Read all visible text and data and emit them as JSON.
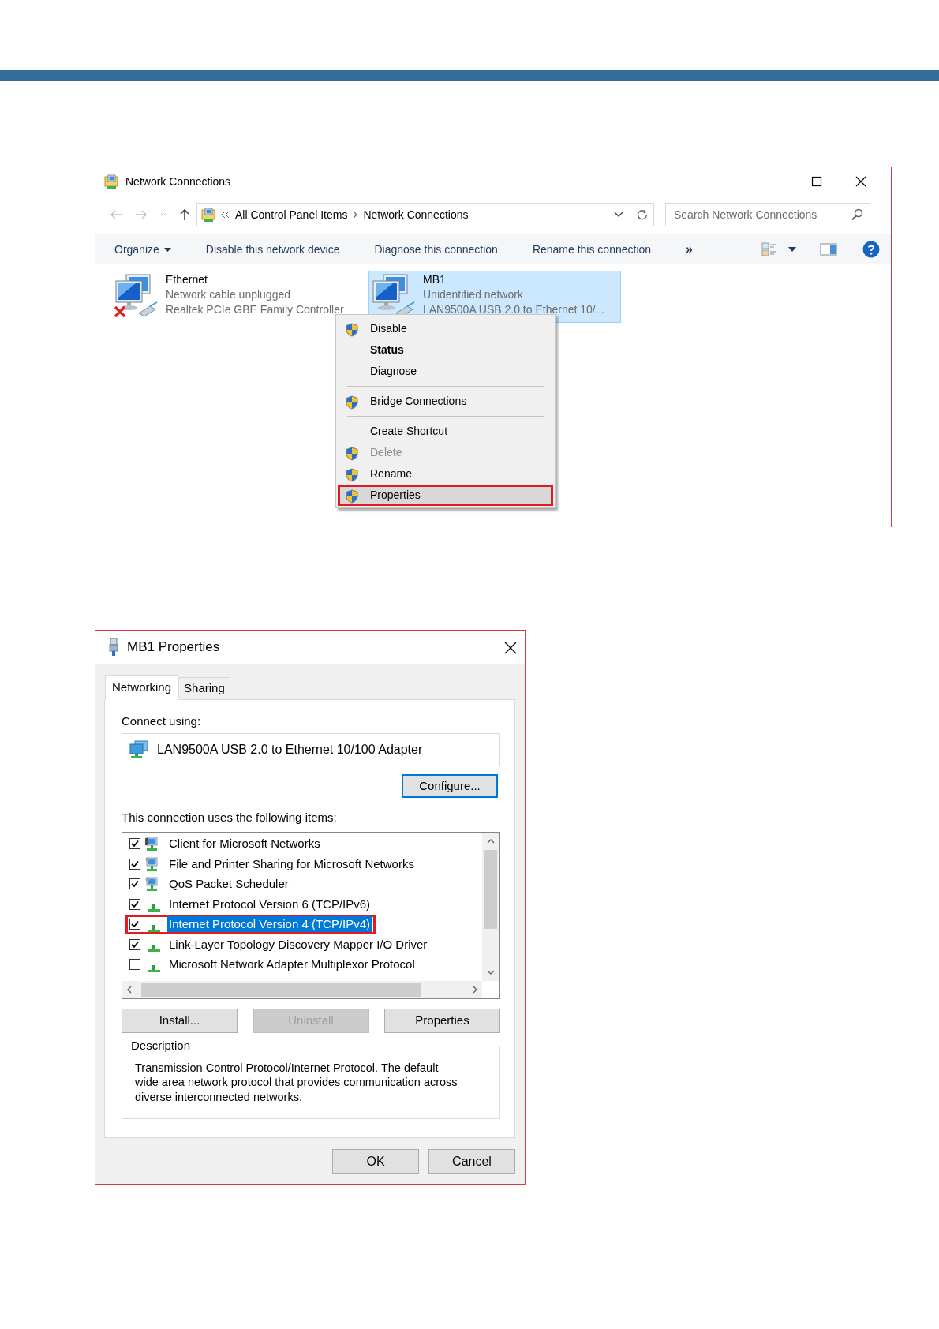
{
  "network_window": {
    "title": "Network Connections",
    "breadcrumb": [
      "All Control Panel Items",
      "Network Connections"
    ],
    "search": {
      "placeholder": "Search Network Connections"
    },
    "toolbar": [
      {
        "label": "Organize",
        "kind": "menu"
      },
      {
        "label": "Disable this network device",
        "kind": "command"
      },
      {
        "label": "Diagnose this connection",
        "kind": "command"
      },
      {
        "label": "Rename this connection",
        "kind": "command"
      },
      {
        "label": "»",
        "kind": "more"
      }
    ],
    "connections": [
      {
        "name": "Ethernet",
        "status": "Network cable unplugged",
        "device": "Realtek PCIe GBE Family Controller",
        "selected": false,
        "disconnected": true
      },
      {
        "name": "MB1",
        "status": "Unidentified network",
        "device": "LAN9500A USB 2.0 to Ethernet 10/...",
        "selected": true,
        "disconnected": false
      }
    ],
    "context_menu": [
      {
        "kind": "item",
        "label": "Disable",
        "shield": true,
        "bold": false,
        "disabled": false,
        "selected": false,
        "annotated": false
      },
      {
        "kind": "item",
        "label": "Status",
        "shield": false,
        "bold": true,
        "disabled": false,
        "selected": false,
        "annotated": false
      },
      {
        "kind": "item",
        "label": "Diagnose",
        "shield": false,
        "bold": false,
        "disabled": false,
        "selected": false,
        "annotated": false
      },
      {
        "kind": "separator"
      },
      {
        "kind": "item",
        "label": "Bridge Connections",
        "shield": true,
        "bold": false,
        "disabled": false,
        "selected": false,
        "annotated": false
      },
      {
        "kind": "separator"
      },
      {
        "kind": "item",
        "label": "Create Shortcut",
        "shield": false,
        "bold": false,
        "disabled": false,
        "selected": false,
        "annotated": false
      },
      {
        "kind": "item",
        "label": "Delete",
        "shield": true,
        "bold": false,
        "disabled": true,
        "selected": false,
        "annotated": false
      },
      {
        "kind": "item",
        "label": "Rename",
        "shield": true,
        "bold": false,
        "disabled": false,
        "selected": false,
        "annotated": false
      },
      {
        "kind": "item",
        "label": "Properties",
        "shield": true,
        "bold": false,
        "disabled": false,
        "selected": true,
        "annotated": true
      }
    ]
  },
  "properties_dialog": {
    "title": "MB1 Properties",
    "tabs": [
      {
        "label": "Networking",
        "selected": true
      },
      {
        "label": "Sharing",
        "selected": false
      }
    ],
    "connect_using_label": "Connect using:",
    "adapter": "LAN9500A USB 2.0 to Ethernet 10/100 Adapter",
    "configure_button": "Configure...",
    "items_label": "This connection uses the following items:",
    "items": [
      {
        "label": "Client for Microsoft Networks",
        "kind": "client",
        "checked": true,
        "selected": false,
        "annotated": false
      },
      {
        "label": "File and Printer Sharing for Microsoft Networks",
        "kind": "service",
        "checked": true,
        "selected": false,
        "annotated": false
      },
      {
        "label": "QoS Packet Scheduler",
        "kind": "service",
        "checked": true,
        "selected": false,
        "annotated": false
      },
      {
        "label": "Internet Protocol Version 6 (TCP/IPv6)",
        "kind": "protocol",
        "checked": true,
        "selected": false,
        "annotated": false
      },
      {
        "label": "Internet Protocol Version 4 (TCP/IPv4)",
        "kind": "protocol",
        "checked": true,
        "selected": true,
        "annotated": true
      },
      {
        "label": "Link-Layer Topology Discovery Mapper I/O Driver",
        "kind": "protocol",
        "checked": true,
        "selected": false,
        "annotated": false
      },
      {
        "label": "Microsoft Network Adapter Multiplexor Protocol",
        "kind": "protocol",
        "checked": false,
        "selected": false,
        "annotated": false
      }
    ],
    "buttons": [
      {
        "label": "Install...",
        "disabled": false
      },
      {
        "label": "Uninstall",
        "disabled": true
      },
      {
        "label": "Properties",
        "disabled": false
      }
    ],
    "description_title": "Description",
    "description": "Transmission Control Protocol/Internet Protocol. The default wide area network protocol that provides communication across diverse interconnected networks.",
    "footer_buttons": [
      "OK",
      "Cancel"
    ]
  }
}
